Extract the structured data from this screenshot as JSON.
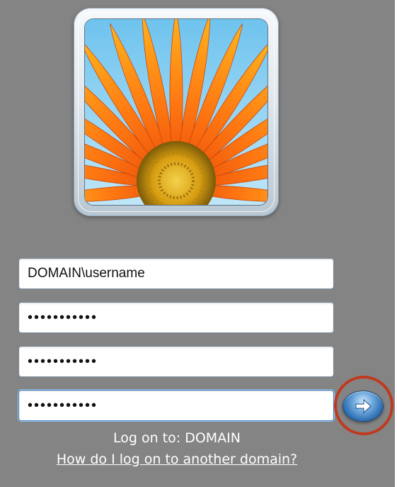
{
  "credentials": {
    "username_value": "DOMAIN\\username",
    "password_value": "•••••••••••",
    "new_password_value": "•••••••••••",
    "confirm_password_value": "•••••••••••"
  },
  "status": {
    "logon_to": "Log on to: DOMAIN",
    "help_link": "How do I log on to another domain?"
  },
  "icons": {
    "avatar": "flower-avatar",
    "submit": "arrow-right-icon",
    "highlight": "red-highlight-circle"
  },
  "colors": {
    "background": "#848484",
    "highlight_ring": "#c0391f",
    "submit_button": "#2e6fb2"
  }
}
